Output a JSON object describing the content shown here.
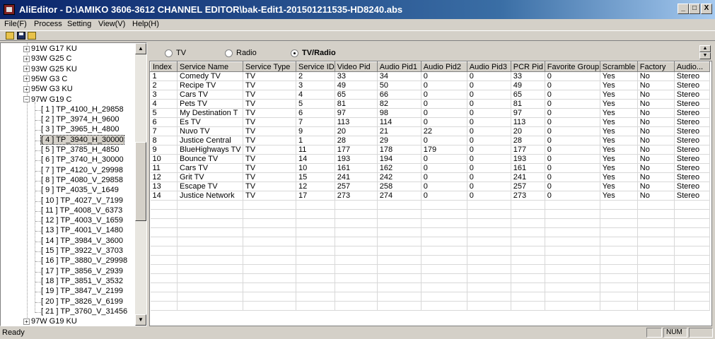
{
  "window": {
    "title": "AliEditor - D:\\AMIKO 3606-3612 CHANNEL EDITOR\\bak-Edit1-201501211535-HD8240.abs"
  },
  "menu": [
    "File(F)",
    "Process",
    "Setting",
    "View(V)",
    "Help(H)"
  ],
  "toolbar": [
    "open-icon",
    "save-icon",
    "open-folder-icon"
  ],
  "tree": {
    "satellites_top": [
      "91W G17 KU",
      "93W G25 C",
      "93W G25 KU",
      "95W G3 C",
      "95W G3 KU"
    ],
    "expanded": "97W G19 C",
    "transponders": [
      "[ 1 ] TP_4100_H_29858",
      "[ 2 ] TP_3974_H_9600",
      "[ 3 ] TP_3965_H_4800",
      "[ 4 ] TP_3940_H_30000",
      "[ 5 ] TP_3785_H_4850",
      "[ 6 ] TP_3740_H_30000",
      "[ 7 ] TP_4120_V_29998",
      "[ 8 ] TP_4080_V_29858",
      "[ 9 ] TP_4035_V_1649",
      "[ 10 ] TP_4027_V_7199",
      "[ 11 ] TP_4008_V_6373",
      "[ 12 ] TP_4003_V_1659",
      "[ 13 ] TP_4001_V_1480",
      "[ 14 ] TP_3984_V_3600",
      "[ 15 ] TP_3922_V_3703",
      "[ 16 ] TP_3880_V_29998",
      "[ 17 ] TP_3856_V_2939",
      "[ 18 ] TP_3851_V_3532",
      "[ 19 ] TP_3847_V_2199",
      "[ 20 ] TP_3826_V_6199",
      "[ 21 ] TP_3760_V_31456"
    ],
    "selected_index": 3,
    "satellite_bottom": "97W G19 KU"
  },
  "radios": {
    "tv": "TV",
    "radio": "Radio",
    "tvradio": "TV/Radio",
    "selected": "tvradio"
  },
  "table": {
    "columns": [
      "Index",
      "Service Name",
      "Service Type",
      "Service ID",
      "Video Pid",
      "Audio Pid1",
      "Audio Pid2",
      "Audio Pid3",
      "PCR Pid",
      "Favorite Group",
      "Scramble",
      "Factory",
      "Audio..."
    ],
    "rows": [
      [
        "1",
        "Comedy TV",
        "TV",
        "2",
        "33",
        "34",
        "0",
        "0",
        "33",
        "0",
        "Yes",
        "No",
        "Stereo"
      ],
      [
        "2",
        "Recipe TV",
        "TV",
        "3",
        "49",
        "50",
        "0",
        "0",
        "49",
        "0",
        "Yes",
        "No",
        "Stereo"
      ],
      [
        "3",
        "Cars TV",
        "TV",
        "4",
        "65",
        "66",
        "0",
        "0",
        "65",
        "0",
        "Yes",
        "No",
        "Stereo"
      ],
      [
        "4",
        "Pets TV",
        "TV",
        "5",
        "81",
        "82",
        "0",
        "0",
        "81",
        "0",
        "Yes",
        "No",
        "Stereo"
      ],
      [
        "5",
        "My Destination T",
        "TV",
        "6",
        "97",
        "98",
        "0",
        "0",
        "97",
        "0",
        "Yes",
        "No",
        "Stereo"
      ],
      [
        "6",
        "Es TV",
        "TV",
        "7",
        "113",
        "114",
        "0",
        "0",
        "113",
        "0",
        "Yes",
        "No",
        "Stereo"
      ],
      [
        "7",
        "Nuvo TV",
        "TV",
        "9",
        "20",
        "21",
        "22",
        "0",
        "20",
        "0",
        "Yes",
        "No",
        "Stereo"
      ],
      [
        "8",
        "Justice Central",
        "TV",
        "1",
        "28",
        "29",
        "0",
        "0",
        "28",
        "0",
        "Yes",
        "No",
        "Stereo"
      ],
      [
        "9",
        "BlueHighways TV",
        "TV",
        "11",
        "177",
        "178",
        "179",
        "0",
        "177",
        "0",
        "Yes",
        "No",
        "Stereo"
      ],
      [
        "10",
        "Bounce TV",
        "TV",
        "14",
        "193",
        "194",
        "0",
        "0",
        "193",
        "0",
        "Yes",
        "No",
        "Stereo"
      ],
      [
        "11",
        "Cars TV",
        "TV",
        "10",
        "161",
        "162",
        "0",
        "0",
        "161",
        "0",
        "Yes",
        "No",
        "Stereo"
      ],
      [
        "12",
        "Grit TV",
        "TV",
        "15",
        "241",
        "242",
        "0",
        "0",
        "241",
        "0",
        "Yes",
        "No",
        "Stereo"
      ],
      [
        "13",
        "Escape TV",
        "TV",
        "12",
        "257",
        "258",
        "0",
        "0",
        "257",
        "0",
        "Yes",
        "No",
        "Stereo"
      ],
      [
        "14",
        "Justice Network",
        "TV",
        "17",
        "273",
        "274",
        "0",
        "0",
        "273",
        "0",
        "Yes",
        "No",
        "Stereo"
      ]
    ]
  },
  "status": {
    "text": "Ready",
    "num": "NUM"
  }
}
